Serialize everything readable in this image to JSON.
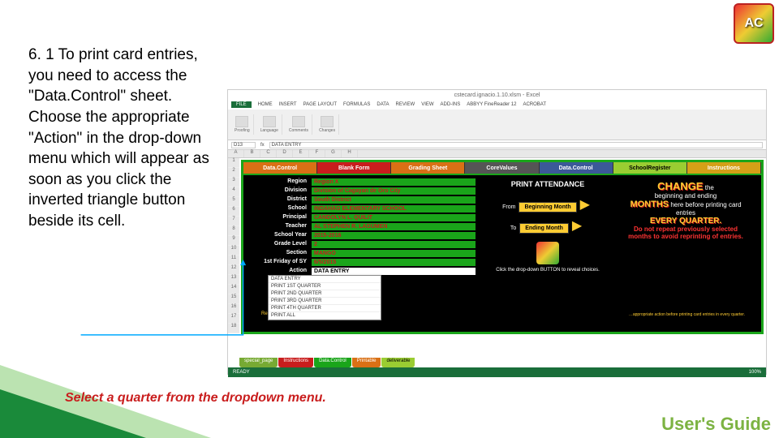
{
  "logo_text": "AC",
  "main_paragraph": "6. 1 To print card entries, you need to access the \"Data.Control\" sheet. Choose the appropriate \"Action\" in the drop-down menu which will appear as soon as you click the inverted triangle button beside its cell.",
  "excel": {
    "title": "cstecard.ignacio.1.10.xlsm - Excel",
    "tabs": [
      "FILE",
      "HOME",
      "INSERT",
      "PAGE LAYOUT",
      "FORMULAS",
      "DATA",
      "REVIEW",
      "VIEW",
      "ADD-INS",
      "ABBYY FineReader 12",
      "ACROBAT"
    ],
    "namebox": "D13",
    "formula": "DATA ENTRY",
    "sheet_tabs": {
      "t1": "special_page",
      "t2": "Instructions",
      "t3": "Data.Control",
      "t4": "Printable",
      "t5": "deliverable"
    },
    "status": "READY"
  },
  "content_tabs": {
    "t1": "Data.Control",
    "t2": "Blank Form",
    "t3": "Grading Sheet",
    "t4": "CoreValues",
    "t5": "Data.Control",
    "t6": "SchoolRegister",
    "t7": "Instructions"
  },
  "form": {
    "region_l": "Region",
    "region_v": "Region X",
    "division_l": "Division",
    "division_v": "Division of Cagayan de Oro City",
    "district_l": "District",
    "district_v": "South District",
    "school_l": "School",
    "school_v": "INDAHAG ELEMENTARY SCHOOL",
    "principal_l": "Principal",
    "principal_v": "CANDOLYN L. QUILIT",
    "teacher_l": "Teacher",
    "teacher_v": "AL STEPHEN R. LAGUMEN",
    "sy_l": "School Year",
    "sy_v": "2015-2016",
    "grade_l": "Grade Level",
    "grade_v": "2",
    "section_l": "Section",
    "section_v": "MANGO",
    "friday_l": "1st Friday of SY",
    "friday_v": "6/5/2015",
    "action_l": "Action",
    "action_v": "DATA ENTRY"
  },
  "dropdown": [
    "DATA ENTRY",
    "PRINT 1ST QUARTER",
    "PRINT 2ND QUARTER",
    "PRINT 3RD QUARTER",
    "PRINT 4TH QUARTER",
    "PRINT ALL"
  ],
  "print": {
    "title": "PRINT ATTENDANCE",
    "from": "From",
    "begin": "Beginning Month",
    "to": "To",
    "end": "Ending Month",
    "hint": "Click the drop-down BUTTON to reveal choices."
  },
  "callout": {
    "change": "CHANGE",
    "t1": "the",
    "t2": "beginning and ending",
    "months": "MONTHS",
    "t3": "here before printing card entries",
    "every": "EVERY QUARTER.",
    "red": "Do not repeat previously selected months to avoid reprinting of entries."
  },
  "redline": "Replace the red entries.",
  "redline2": "…appropriate action before printing card entries in every quarter.",
  "caption": "Select a quarter from the dropdown menu.",
  "footer": "User's Guide"
}
